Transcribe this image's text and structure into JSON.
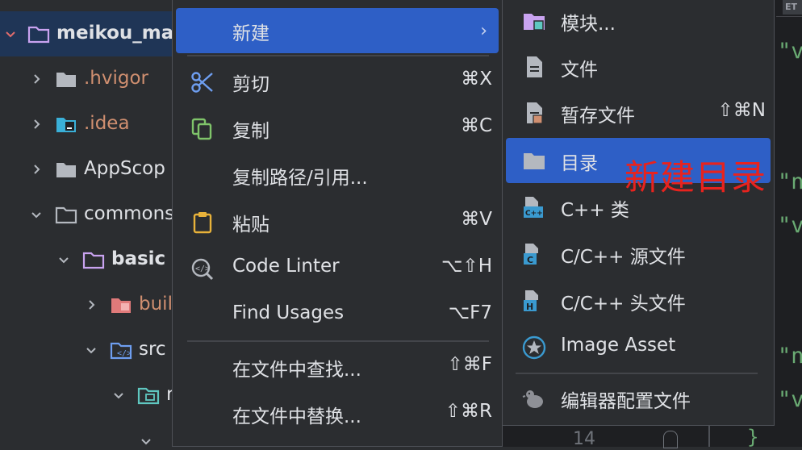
{
  "project_tree": {
    "items": [
      {
        "label": "meikou_ma",
        "kind": "module-root"
      },
      {
        "label": ".hvigor",
        "kind": "folder"
      },
      {
        "label": ".idea",
        "kind": "idea-folder"
      },
      {
        "label": "AppScop",
        "kind": "folder"
      },
      {
        "label": "commons",
        "kind": "folder-open"
      },
      {
        "label": "basic",
        "kind": "module"
      },
      {
        "label": "buil",
        "kind": "build-folder"
      },
      {
        "label": "src",
        "kind": "src-folder"
      },
      {
        "label": "r",
        "kind": "resource-folder"
      }
    ]
  },
  "context_menu": {
    "items": [
      {
        "label": "新建",
        "shortcut": "",
        "icon": "none",
        "submenu": true
      },
      {
        "label": "剪切",
        "shortcut": "⌘X",
        "icon": "scissors-icon"
      },
      {
        "label": "复制",
        "shortcut": "⌘C",
        "icon": "copy-icon"
      },
      {
        "label": "复制路径/引用...",
        "shortcut": "",
        "icon": "none"
      },
      {
        "label": "粘贴",
        "shortcut": "⌘V",
        "icon": "paste-icon"
      },
      {
        "label": "Code Linter",
        "shortcut": "⌥⇧H",
        "icon": "code-linter-icon"
      },
      {
        "label": "Find Usages",
        "shortcut": "⌥F7",
        "icon": "none"
      },
      {
        "label": "在文件中查找...",
        "shortcut": "⇧⌘F",
        "icon": "none"
      },
      {
        "label": "在文件中替换...",
        "shortcut": "⇧⌘R",
        "icon": "none"
      }
    ],
    "submenu_arrow": "›"
  },
  "new_submenu": {
    "items": [
      {
        "label": "模块...",
        "shortcut": "",
        "icon": "module-icon"
      },
      {
        "label": "文件",
        "shortcut": "",
        "icon": "file-icon"
      },
      {
        "label": "暂存文件",
        "shortcut": "⇧⌘N",
        "icon": "scratch-file-icon"
      },
      {
        "label": "目录",
        "shortcut": "",
        "icon": "directory-icon"
      },
      {
        "label": "C++ 类",
        "shortcut": "",
        "icon": "cpp-class-icon"
      },
      {
        "label": "C/C++ 源文件",
        "shortcut": "",
        "icon": "c-source-icon"
      },
      {
        "label": "C/C++ 头文件",
        "shortcut": "",
        "icon": "c-header-icon"
      },
      {
        "label": "Image Asset",
        "shortcut": "",
        "icon": "image-asset-icon"
      },
      {
        "label": "编辑器配置文件",
        "shortcut": "",
        "icon": "editorconfig-icon"
      }
    ]
  },
  "annotation": "新建目录",
  "editor": {
    "tab_label": "ET",
    "fragments": [
      "\"v",
      "\"n",
      "\"v",
      "\"n",
      "\"v"
    ],
    "line_number": "14",
    "brace": "}"
  },
  "colors": {
    "accent": "#2e5fc6",
    "menu_bg": "#2b2d30",
    "annotation": "#e8231e",
    "string_green": "#6aab73"
  }
}
